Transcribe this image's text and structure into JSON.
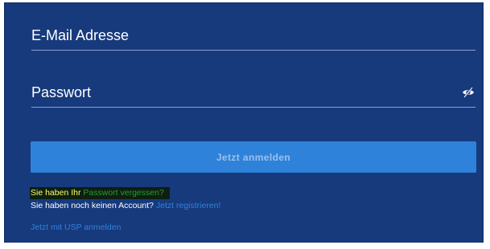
{
  "form": {
    "email": {
      "placeholder": "E-Mail Adresse",
      "value": ""
    },
    "password": {
      "placeholder": "Passwort",
      "value": "",
      "toggle_icon": "eye-slash-icon"
    },
    "submit_label": "Jetzt anmelden",
    "forgot": {
      "prefix": "Sie haben Ihr ",
      "link": "Passwort vergessen?"
    },
    "register": {
      "prefix": "Sie haben noch keinen Account? ",
      "link": "Jetzt registrieren!"
    },
    "usp_link": "Jetzt mit USP anmelden"
  },
  "colors": {
    "panel_bg": "#173a7d",
    "button_bg": "#2f82da",
    "link": "#2f82da",
    "highlight_bg": "#0d1f12",
    "highlight_text": "#ffff66",
    "highlight_link": "#2d9a2f"
  }
}
